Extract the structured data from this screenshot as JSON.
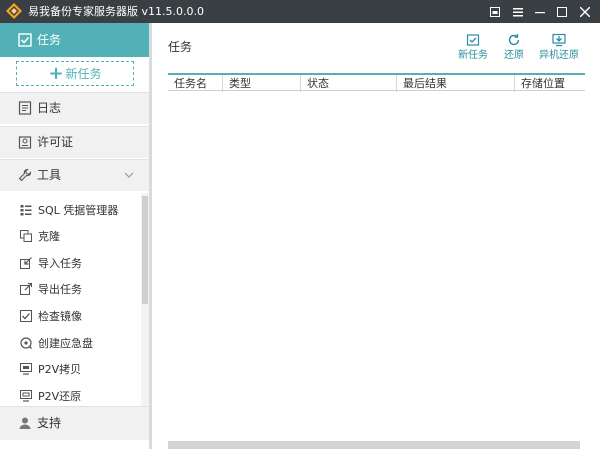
{
  "window": {
    "title": "易我备份专家服务器版 v11.5.0.0.0"
  },
  "sidebar": {
    "task": {
      "label": "任务",
      "icon": "checkbox-icon"
    },
    "new_task": {
      "label": "新任务",
      "icon": "plus-icon"
    },
    "log": {
      "label": "日志",
      "icon": "log-icon"
    },
    "license": {
      "label": "许可证",
      "icon": "license-icon"
    },
    "tools": {
      "label": "工具",
      "icon": "wrench-icon"
    },
    "tool_items": [
      {
        "label": "SQL 凭据管理器",
        "icon": "list-icon"
      },
      {
        "label": "克隆",
        "icon": "clone-icon"
      },
      {
        "label": "导入任务",
        "icon": "import-icon"
      },
      {
        "label": "导出任务",
        "icon": "export-icon"
      },
      {
        "label": "检查镜像",
        "icon": "check-image-icon"
      },
      {
        "label": "创建应急盘",
        "icon": "emergency-disk-icon"
      },
      {
        "label": "P2V拷贝",
        "icon": "p2v-copy-icon"
      },
      {
        "label": "P2V还原",
        "icon": "p2v-restore-icon"
      }
    ],
    "support": {
      "label": "支持",
      "icon": "user-icon"
    }
  },
  "main": {
    "title": "任务",
    "toolbar": [
      {
        "label": "新任务",
        "icon": "new-task-icon"
      },
      {
        "label": "还原",
        "icon": "restore-icon"
      },
      {
        "label": "异机还原",
        "icon": "remote-restore-icon"
      }
    ],
    "table": {
      "columns": [
        "任务名",
        "类型",
        "状态",
        "最后结果",
        "存储位置"
      ]
    }
  },
  "colors": {
    "titlebar": "#3a3f44",
    "accent": "#52b1b7",
    "toolbar_text": "#2a8ea0",
    "nav_bg": "#f1f1f2"
  }
}
